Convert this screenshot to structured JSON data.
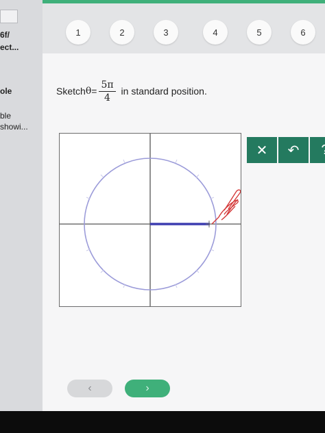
{
  "sidebar": {
    "line1": "6f/",
    "line2": "ect...",
    "line3": "ole",
    "line4": "ble",
    "line5": "showi..."
  },
  "steps": [
    "1",
    "2",
    "3",
    "4",
    "5",
    "6"
  ],
  "question": {
    "prefix": "Sketch ",
    "theta": "θ",
    "equals": " = ",
    "numerator": "5π",
    "denominator": "4",
    "suffix": "in standard position."
  },
  "toolbar": {
    "clear_icon": "x-icon",
    "clear_glyph": "✕",
    "undo_icon": "undo-icon",
    "undo_glyph": "↶",
    "help_icon": "help-icon",
    "help_glyph": "?"
  },
  "nav": {
    "prev_glyph": "‹",
    "next_glyph": "›"
  },
  "colors": {
    "accent": "#3fb07a",
    "toolbar": "#247a5f",
    "circle": "#9b9bd9",
    "ray": "#3d3db0",
    "cursor": "#d43a3a"
  }
}
